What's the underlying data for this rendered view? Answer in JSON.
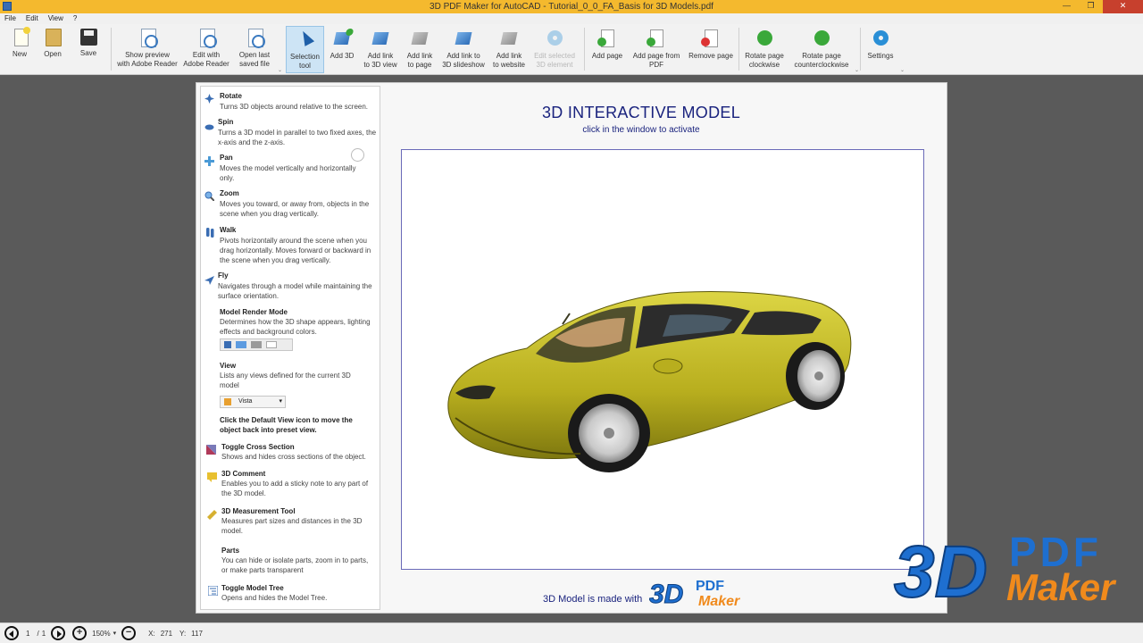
{
  "window": {
    "title": "3D PDF Maker for AutoCAD - Tutorial_0_0_FA_Basis for 3D Models.pdf",
    "controls": [
      "—",
      "❐",
      "✕"
    ]
  },
  "menu": [
    "File",
    "Edit",
    "View",
    "?"
  ],
  "ribbon": {
    "new": "New",
    "open": "Open",
    "save": "Save",
    "preview": "Show preview\nwith Adobe Reader",
    "edit_adobe": "Edit with\nAdobe Reader",
    "open_last": "Open last\nsaved file",
    "selection": "Selection\ntool",
    "add3d": "Add 3D",
    "link_3dview": "Add link\nto 3D view",
    "link_page": "Add link\nto page",
    "link_slideshow": "Add link to\n3D slideshow",
    "link_website": "Add link\nto website",
    "edit_selected": "Edit selected\n3D element",
    "add_page": "Add page",
    "add_page_pdf": "Add page from\nPDF",
    "remove_page": "Remove page",
    "rot_cw": "Rotate page\nclockwise",
    "rot_ccw": "Rotate page\ncounterclockwise",
    "settings": "Settings"
  },
  "help": [
    {
      "title": "Rotate",
      "desc": "Turns 3D objects around relative to the screen."
    },
    {
      "title": "Spin",
      "desc": "Turns a 3D model in parallel to two fixed axes, the x-axis and the z-axis."
    },
    {
      "title": "Pan",
      "desc": "Moves the model vertically and horizontally only."
    },
    {
      "title": "Zoom",
      "desc": "Moves you toward, or away from, objects in the scene when you drag vertically."
    },
    {
      "title": "Walk",
      "desc": "Pivots horizontally around the scene when you drag horizontally. Moves forward or backward in the scene when you drag vertically."
    },
    {
      "title": "Fly",
      "desc": "Navigates through a model while maintaining the surface orientation."
    },
    {
      "title": "Model Render Mode",
      "desc": "Determines how the 3D shape appears, lighting effects and background colors."
    },
    {
      "title": "View",
      "desc": "Lists any views defined for the current 3D model",
      "dropdown": "Vista"
    },
    {
      "title": "Click the Default View icon to move the object back into  preset view.",
      "desc": ""
    },
    {
      "title": "Toggle Cross Section",
      "desc": "Shows and hides cross sections of the object."
    },
    {
      "title": "3D Comment",
      "desc": "Enables you to add a sticky note to any part of the 3D model."
    },
    {
      "title": "3D Measurement Tool",
      "desc": "Measures part sizes and distances in the 3D model."
    },
    {
      "title": "Parts",
      "desc": "You can hide or isolate parts, zoom in to parts, or make parts transparent"
    },
    {
      "title": "Toggle Model Tree",
      "desc": "Opens and hides the Model Tree."
    }
  ],
  "model": {
    "title": "3D INTERACTIVE MODEL",
    "subtitle": "click in the window to activate",
    "made_with": "3D Model is made with",
    "logo_3d": "3D",
    "logo_pdf": "PDF",
    "logo_maker": "Maker"
  },
  "status": {
    "page": "1",
    "page_sep": "/",
    "page_total": "1",
    "zoom": "150%",
    "x_label": "X:",
    "x": "271",
    "y_label": "Y:",
    "y": "117"
  },
  "colors": {
    "titlebar": "#f4b92e",
    "accent": "#1a237e",
    "car_body": "#c8c02a",
    "logo_blue": "#1e6fd0",
    "logo_orange": "#f08a1c"
  }
}
